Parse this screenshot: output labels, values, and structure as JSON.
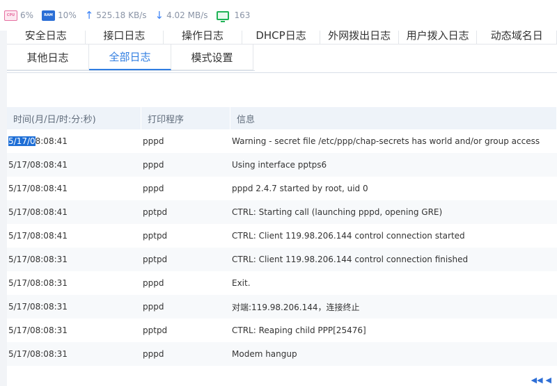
{
  "status": {
    "cpu_badge": "CPU",
    "cpu": "6%",
    "ram_badge": "RAM",
    "ram": "10%",
    "upload": "525.18 KB/s",
    "download": "4.02 MB/s",
    "connections": "163"
  },
  "tabs": {
    "row1": [
      "安全日志",
      "接口日志",
      "操作日志",
      "DHCP日志",
      "外网拨出日志",
      "用户拨入日志",
      "动态域名日"
    ],
    "row2": [
      "其他日志",
      "全部日志",
      "模式设置"
    ],
    "active": "全部日志"
  },
  "table": {
    "headers": [
      "时间(月/日/时:分:秒)",
      "打印程序",
      "信息"
    ],
    "rows": [
      {
        "time_sel": "5/17/0",
        "time_rest": "8:08:41",
        "prog": "pppd",
        "msg": "Warning - secret file /etc/ppp/chap-secrets has world and/or group access"
      },
      {
        "time": "5/17/08:08:41",
        "prog": "pppd",
        "msg": "Using interface pptps6"
      },
      {
        "time": "5/17/08:08:41",
        "prog": "pppd",
        "msg": "pppd 2.4.7 started by root, uid 0"
      },
      {
        "time": "5/17/08:08:41",
        "prog": "pptpd",
        "msg": "CTRL: Starting call (launching pppd, opening GRE)"
      },
      {
        "time": "5/17/08:08:41",
        "prog": "pptpd",
        "msg": "CTRL: Client 119.98.206.144 control connection started"
      },
      {
        "time": "5/17/08:08:31",
        "prog": "pptpd",
        "msg": "CTRL: Client 119.98.206.144 control connection finished"
      },
      {
        "time": "5/17/08:08:31",
        "prog": "pppd",
        "msg": "Exit."
      },
      {
        "time": "5/17/08:08:31",
        "prog": "pppd",
        "msg": "对端:119.98.206.144，连接终止"
      },
      {
        "time": "5/17/08:08:31",
        "prog": "pptpd",
        "msg": "CTRL: Reaping child PPP[25476]"
      },
      {
        "time": "5/17/08:08:31",
        "prog": "pppd",
        "msg": "Modem hangup"
      }
    ]
  }
}
